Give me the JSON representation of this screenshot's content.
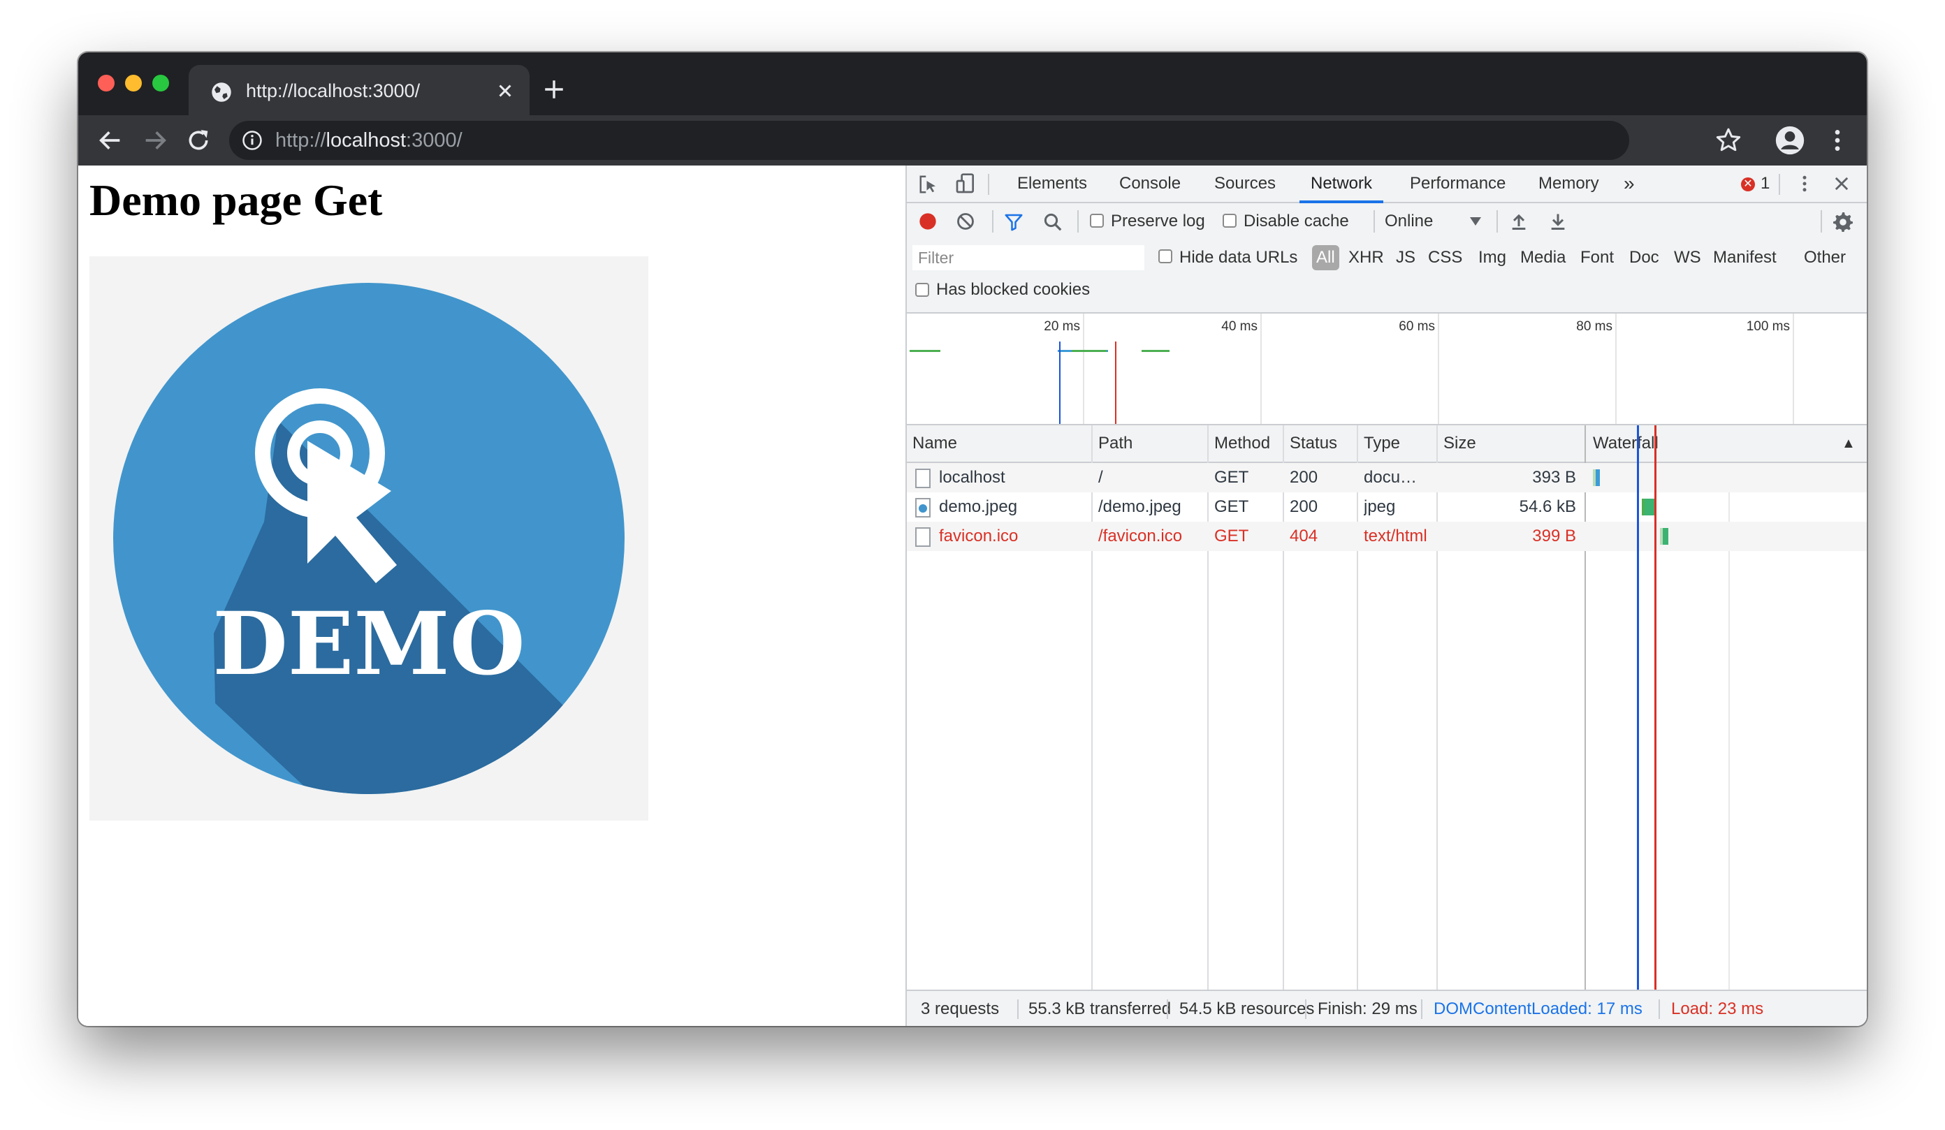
{
  "tab": {
    "title": "http://localhost:3000/"
  },
  "omnibox": {
    "scheme": "http://",
    "host": "localhost",
    "rest": ":3000/"
  },
  "page": {
    "title": "Demo page Get",
    "image_text": "DEMO"
  },
  "devtools": {
    "tabs": [
      "Elements",
      "Console",
      "Sources",
      "Network",
      "Performance",
      "Memory"
    ],
    "active_tab": "Network",
    "more_tabs": "»",
    "error_count": "1",
    "error_glyph": "✕",
    "toolbar": {
      "preserve_log": "Preserve log",
      "disable_cache": "Disable cache",
      "throttling": "Online"
    },
    "filter": {
      "placeholder": "Filter",
      "hide_data_urls": "Hide data URLs",
      "types": [
        "All",
        "XHR",
        "JS",
        "CSS",
        "Img",
        "Media",
        "Font",
        "Doc",
        "WS",
        "Manifest",
        "Other"
      ],
      "has_blocked_cookies": "Has blocked cookies"
    },
    "overview": {
      "ticks": [
        "20 ms",
        "40 ms",
        "60 ms",
        "80 ms",
        "100 ms"
      ]
    },
    "table": {
      "columns": [
        "Name",
        "Path",
        "Method",
        "Status",
        "Type",
        "Size",
        "Waterfall"
      ],
      "sort_glyph": "▲",
      "rows": [
        {
          "name": "localhost",
          "path": "/",
          "method": "GET",
          "status": "200",
          "type": "docu…",
          "size": "393 B"
        },
        {
          "name": "demo.jpeg",
          "path": "/demo.jpeg",
          "method": "GET",
          "status": "200",
          "type": "jpeg",
          "size": "54.6 kB"
        },
        {
          "name": "favicon.ico",
          "path": "/favicon.ico",
          "method": "GET",
          "status": "404",
          "type": "text/html",
          "size": "399 B"
        }
      ]
    },
    "status": {
      "requests": "3 requests",
      "transferred": "55.3 kB transferred",
      "resources": "54.5 kB resources",
      "finish": "Finish: 29 ms",
      "dom_content_loaded": "DOMContentLoaded: 17 ms",
      "load": "Load: 23 ms"
    },
    "colors": {
      "accent": "#1a73e8",
      "error": "#d93025",
      "record": "#d93025"
    }
  }
}
